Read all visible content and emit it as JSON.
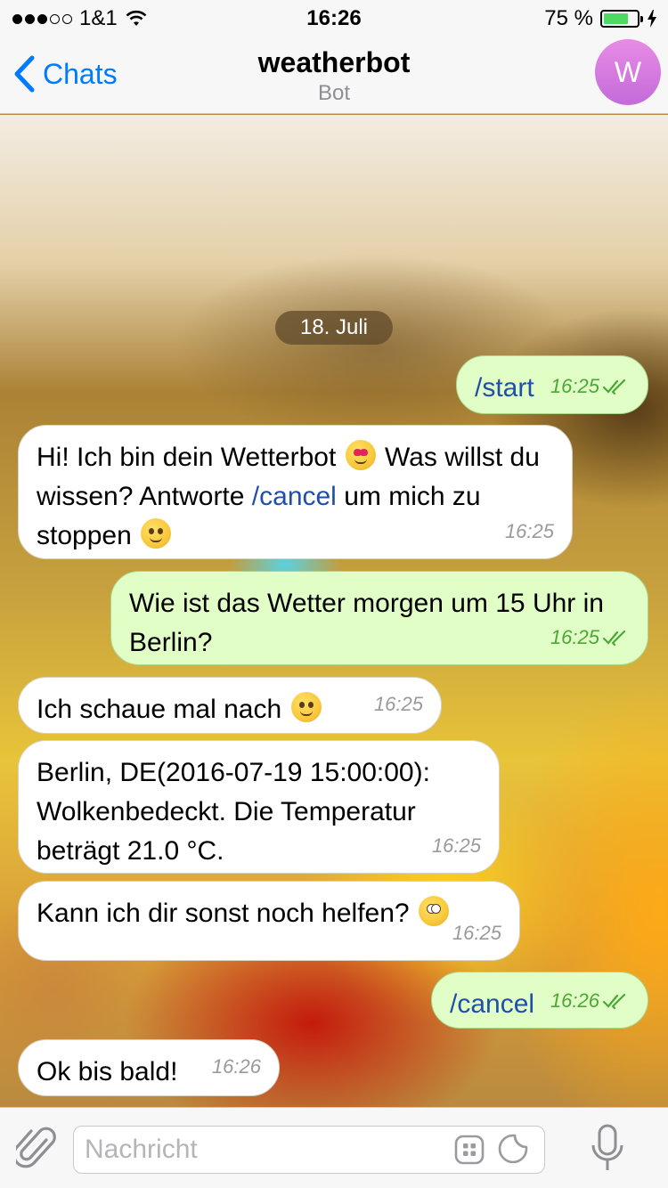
{
  "status_bar": {
    "carrier": "1&1",
    "time": "16:26",
    "battery_percent": "75 %",
    "battery_level": 0.75,
    "signal_bars": 3
  },
  "nav": {
    "back_label": "Chats",
    "title": "weatherbot",
    "subtitle": "Bot",
    "avatar_letter": "W",
    "avatar_color": "#d07ae0",
    "accent_color": "#007aff"
  },
  "chat": {
    "date_label": "18. Juli",
    "messages": [
      {
        "direction": "out",
        "text": "/start",
        "time": "16:25",
        "read": true
      },
      {
        "direction": "in",
        "text_parts": [
          "Hi! Ich bin dein Wetterbot",
          " Was willst du wissen?  Antworte ",
          "/cancel",
          " um mich zu stoppen"
        ],
        "emojis": [
          "heart-eyes",
          "winking-face"
        ],
        "time": "16:25"
      },
      {
        "direction": "out",
        "text": "Wie ist das Wetter morgen um 15 Uhr in Berlin?",
        "time": "16:25",
        "read": true
      },
      {
        "direction": "in",
        "text": "Ich schaue mal nach",
        "emojis": [
          "smiling-face"
        ],
        "time": "16:25"
      },
      {
        "direction": "in",
        "text": "Berlin, DE(2016-07-19 15:00:00): Wolkenbedeckt. Die Temperatur beträgt 21.0 °C.",
        "time": "16:25"
      },
      {
        "direction": "in",
        "text": "Kann ich dir sonst noch helfen?",
        "emojis": [
          "eye-roll"
        ],
        "time": "16:25"
      },
      {
        "direction": "out",
        "text": "/cancel",
        "time": "16:26",
        "read": true
      },
      {
        "direction": "in",
        "text": "Ok bis bald!",
        "time": "16:26"
      }
    ]
  },
  "input": {
    "placeholder": "Nachricht",
    "value": ""
  },
  "colors": {
    "outgoing_bubble": "#e1fec6",
    "incoming_bubble": "#ffffff",
    "read_check": "#4aa835",
    "command_link": "#1f4fa8"
  }
}
